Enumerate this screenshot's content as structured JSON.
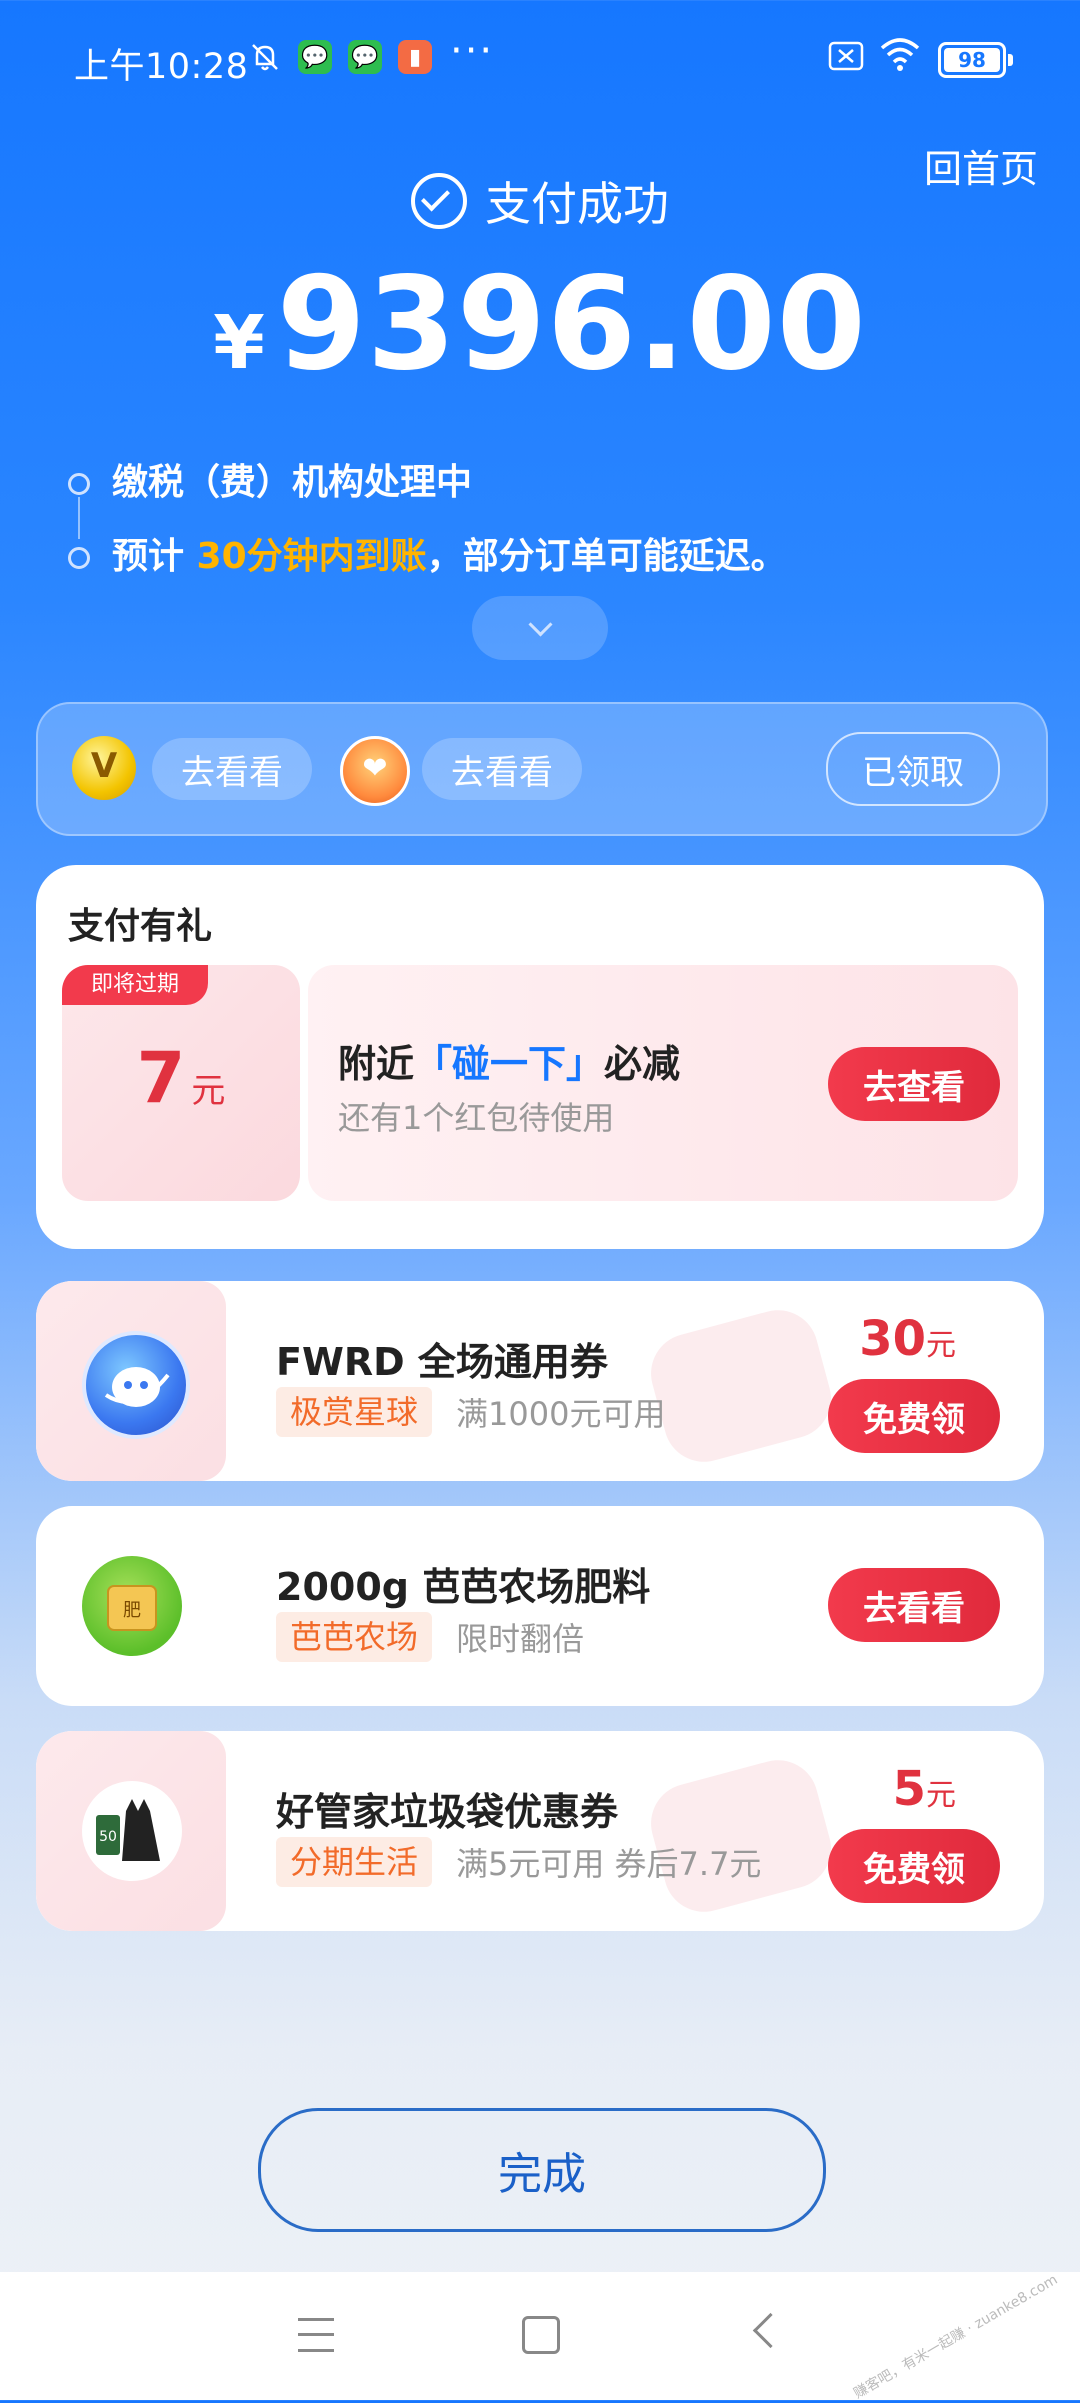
{
  "status_bar": {
    "time": "上午10:28",
    "icons": [
      "bell-off-icon",
      "wechat-icon",
      "wechat-icon",
      "app-icon",
      "more-dots-icon"
    ],
    "more": "···",
    "battery": "98"
  },
  "header": {
    "home_link": "回首页",
    "status": "支付成功",
    "currency": "¥",
    "amount": "9396.00"
  },
  "timeline": {
    "step1": "缴税（费）机构处理中",
    "step2_prefix": "预计 ",
    "step2_highlight": "30分钟内到账",
    "step2_suffix": "，部分订单可能延迟。"
  },
  "promo_strip": {
    "pill1": "去看看",
    "pill2": "去看看",
    "claimed": "已领取"
  },
  "gift": {
    "title": "支付有礼",
    "expire_tag": "即将过期",
    "amount": "7",
    "unit": "元",
    "title_prefix": "附近",
    "title_highlight": "「碰一下」",
    "title_suffix": "必减",
    "subtitle": "还有1个红包待使用",
    "button": "去查看"
  },
  "offers": [
    {
      "title": "FWRD 全场通用券",
      "tag": "极赏星球",
      "desc": "满1000元可用",
      "price": "30",
      "unit": "元",
      "button": "免费领"
    },
    {
      "title": "2000g 芭芭农场肥料",
      "tag": "芭芭农场",
      "desc": "限时翻倍",
      "button": "去看看"
    },
    {
      "title": "好管家垃圾袋优惠券",
      "tag": "分期生活",
      "desc": "满5元可用 券后7.7元",
      "price": "5",
      "unit": "元",
      "button": "免费领"
    }
  ],
  "done_button": "完成",
  "watermark": "赚客吧，有米一起赚 · zuanke8.com",
  "colors": {
    "primary_blue": "#1677ff",
    "accent_red": "#e0323f",
    "highlight_orange": "#ffb400"
  }
}
